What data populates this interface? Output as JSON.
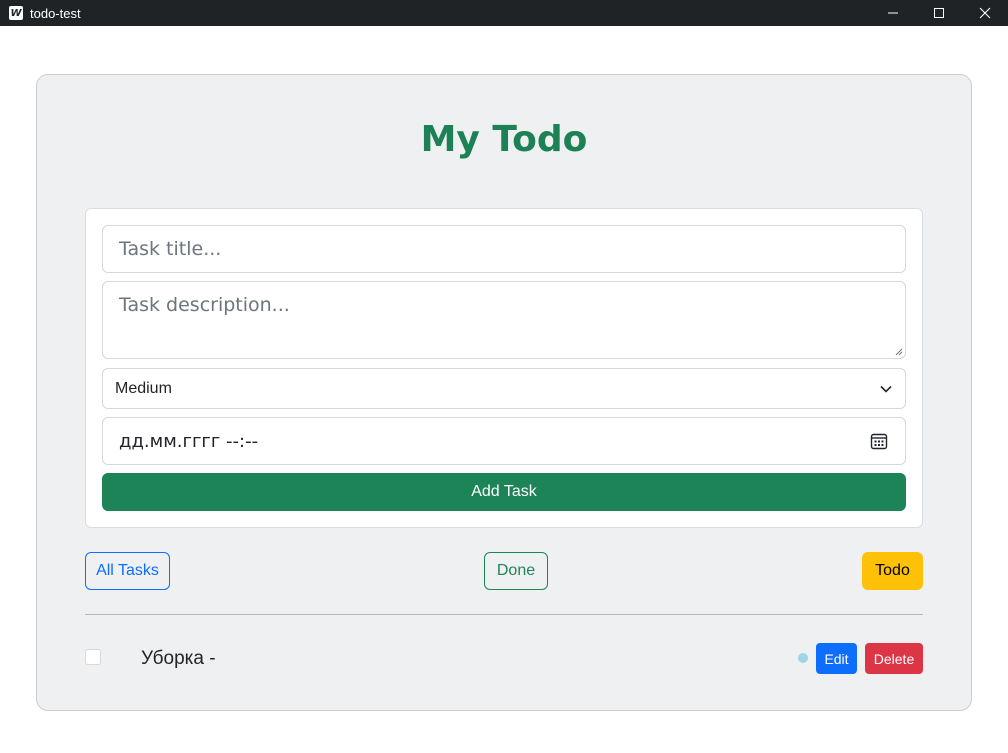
{
  "window": {
    "title": "todo-test",
    "app_icon_letter": "W"
  },
  "app": {
    "heading": "My Todo"
  },
  "form": {
    "title_placeholder": "Task title...",
    "description_placeholder": "Task description...",
    "priority_selected": "Medium",
    "date_placeholder": "дд.мм.гггг --:--",
    "add_button": "Add Task"
  },
  "filters": {
    "all": "All Tasks",
    "done": "Done",
    "todo": "Todo"
  },
  "tasks": [
    {
      "title": "Уборка -",
      "checked": false,
      "priority_color": "#9fd5e4",
      "edit_label": "Edit",
      "delete_label": "Delete"
    }
  ],
  "colors": {
    "accent_green": "#1c8456",
    "primary_blue": "#0d6efd",
    "warning_yellow": "#ffc107",
    "danger_red": "#dc3545"
  },
  "icons": {
    "priority_dropdown": "chevron-down-icon",
    "date_picker": "calendar-icon"
  }
}
